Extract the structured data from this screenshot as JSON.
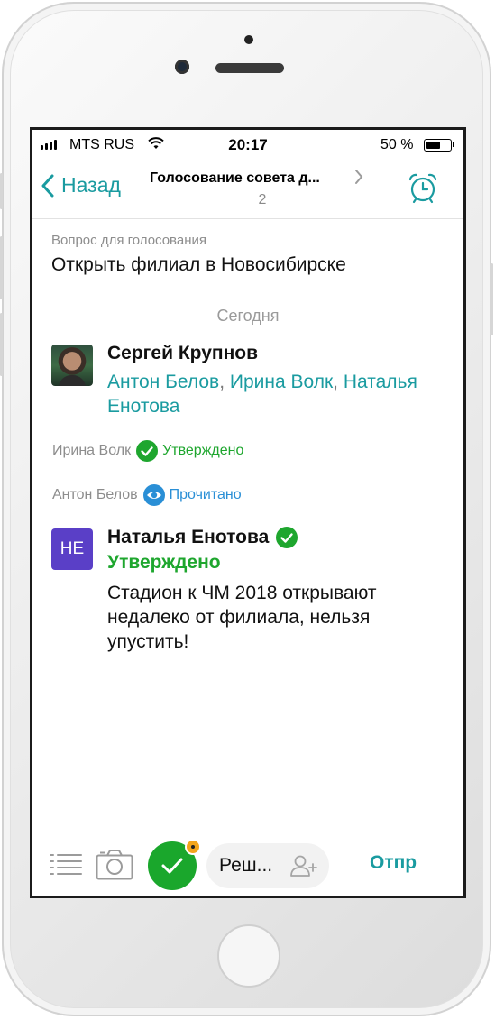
{
  "status_bar": {
    "carrier": "MTS RUS",
    "time": "20:17",
    "battery": "50 %"
  },
  "nav": {
    "back_label": "Назад",
    "title": "Голосование совета д...",
    "subtitle": "2"
  },
  "question": {
    "label": "Вопрос для голосования",
    "text": "Открыть филиал в Новосибирске"
  },
  "day_separator": "Сегодня",
  "message1": {
    "author": "Сергей Крупнов",
    "recipients": [
      "Антон Белов",
      "Ирина Волк",
      "Наталья Енотова"
    ],
    "separator": ", "
  },
  "status_events": [
    {
      "who": "Ирина Волк",
      "status": "Утверждено"
    },
    {
      "who": "Антон Белов",
      "status": "Прочитано"
    }
  ],
  "message2": {
    "avatar_initials": "НЕ",
    "author": "Наталья Енотова",
    "status": "Утверждено",
    "text": "Стадион к ЧМ 2018 открывают недалеко от филиала, нельзя упустить!"
  },
  "toolbar": {
    "input_value": "Реш...",
    "send_label": "Отпр"
  },
  "colors": {
    "accent": "#1a9ba0",
    "approved": "#1ea62e",
    "read": "#2a8fd6",
    "avatar_he": "#5a3fc7",
    "badge": "#f3a51c"
  },
  "icons": [
    "back-chevron-icon",
    "alarm-clock-icon",
    "check-circle-icon",
    "eye-icon",
    "list-icon",
    "camera-icon",
    "checkmark-icon",
    "add-person-icon"
  ]
}
